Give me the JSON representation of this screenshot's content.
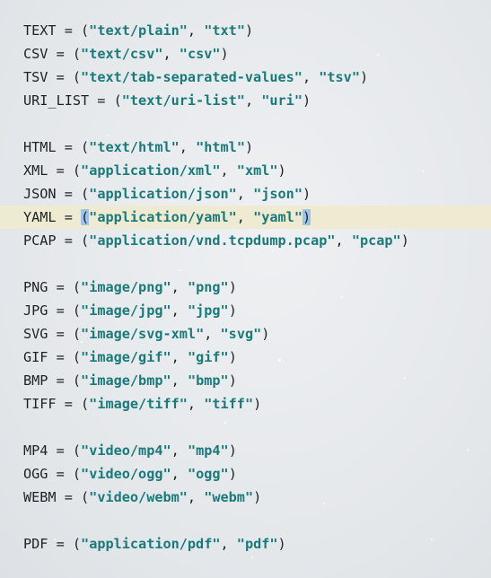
{
  "groups": [
    {
      "lines": [
        {
          "name": "TEXT",
          "mime": "text/plain",
          "ext": "txt"
        },
        {
          "name": "CSV",
          "mime": "text/csv",
          "ext": "csv"
        },
        {
          "name": "TSV",
          "mime": "text/tab-separated-values",
          "ext": "tsv"
        },
        {
          "name": "URI_LIST",
          "mime": "text/uri-list",
          "ext": "uri"
        }
      ]
    },
    {
      "lines": [
        {
          "name": "HTML",
          "mime": "text/html",
          "ext": "html"
        },
        {
          "name": "XML",
          "mime": "application/xml",
          "ext": "xml"
        },
        {
          "name": "JSON",
          "mime": "application/json",
          "ext": "json"
        },
        {
          "name": "YAML",
          "mime": "application/yaml",
          "ext": "yaml",
          "current": true
        },
        {
          "name": "PCAP",
          "mime": "application/vnd.tcpdump.pcap",
          "ext": "pcap"
        }
      ]
    },
    {
      "lines": [
        {
          "name": "PNG",
          "mime": "image/png",
          "ext": "png"
        },
        {
          "name": "JPG",
          "mime": "image/jpg",
          "ext": "jpg"
        },
        {
          "name": "SVG",
          "mime": "image/svg-xml",
          "ext": "svg"
        },
        {
          "name": "GIF",
          "mime": "image/gif",
          "ext": "gif"
        },
        {
          "name": "BMP",
          "mime": "image/bmp",
          "ext": "bmp"
        },
        {
          "name": "TIFF",
          "mime": "image/tiff",
          "ext": "tiff"
        }
      ]
    },
    {
      "lines": [
        {
          "name": "MP4",
          "mime": "video/mp4",
          "ext": "mp4"
        },
        {
          "name": "OGG",
          "mime": "video/ogg",
          "ext": "ogg"
        },
        {
          "name": "WEBM",
          "mime": "video/webm",
          "ext": "webm"
        }
      ]
    },
    {
      "lines": [
        {
          "name": "PDF",
          "mime": "application/pdf",
          "ext": "pdf"
        }
      ]
    }
  ],
  "colors": {
    "string": "#1a7a7a",
    "identifier": "#1d2226",
    "current_line": "#efead2",
    "bracket_match": "#9ec3ea"
  }
}
